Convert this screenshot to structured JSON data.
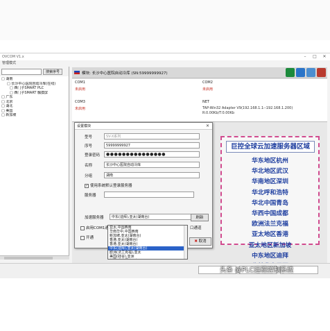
{
  "window": {
    "title": "OVCOM V1.x",
    "menu": "管理模式"
  },
  "left": {
    "search_button": "搜索序号",
    "tree": [
      {
        "label": "□ 湖南",
        "level": 1
      },
      {
        "label": "□ 长沙中心医院自动冷库(在线)",
        "level": 2
      },
      {
        "label": "□ 西门子SMART PLC",
        "level": 3
      },
      {
        "label": "□ 西门子SMART 触摸屏",
        "level": 3
      },
      {
        "label": "□ 广东",
        "level": 1
      },
      {
        "label": "□ 北京",
        "level": 1
      },
      {
        "label": "□ 湖北",
        "level": 1
      },
      {
        "label": "□ 美国",
        "level": 1
      },
      {
        "label": "□ 新加坡",
        "level": 1
      }
    ]
  },
  "device": {
    "title": "模块: 长沙中心医院自动冷库 (SN:59999999927)"
  },
  "ports": {
    "com1": {
      "name": "COM1",
      "state": "未启用"
    },
    "com2": {
      "name": "COM2",
      "state": "未启用"
    },
    "com3": {
      "name": "COM3",
      "state": "未启用"
    },
    "net": {
      "name": "NET",
      "line1": "TAP-Win32 Adapter V9(192.168.1.1--192.168.1.200)",
      "line2": "R:0.00Kb/T:0.00Kb"
    }
  },
  "dialog": {
    "title": "设置模块",
    "labels": {
      "model": "型号",
      "serial": "序号",
      "password": "登录密码",
      "name": "名称",
      "group": "分组",
      "server": "服务器",
      "accel": "加速服务器"
    },
    "values": {
      "model": "SV-X系列",
      "serial": "59999999927",
      "password": "●●●●●●●●●●●●●●●",
      "name": "长沙中心医院自动冷库",
      "group": "湖南",
      "server": "",
      "accel": "中东(迪拜),亚太(湖南台)"
    },
    "use_default_server": "使用系统默认登录服务器",
    "refresh": "刷新",
    "com1_option": "启用COM1通道",
    "com3_option": "开通",
    "com2_suffix": "口通道",
    "cancel": "取消",
    "cancel_icon": "red-x-icon",
    "dropdown_items": [
      "亚太,中国西南",
      "华南华中,中国西南",
      "新加坡,亚太(湖南台)",
      "香港,亚太(湖南台)",
      "香港,亚太(湖南台)",
      "中东(迪拜),亚太(湖南台)",
      "欧洲(法兰克福),亚太",
      "美国(硅谷),亚洲",
      "美国(弗吉尼亚),欧洲"
    ],
    "dropdown_selected_index": 5
  },
  "panel": {
    "title": "巨控全球云加速服务器区域",
    "regions": [
      "华东地区杭州",
      "华北地区武汉",
      "华南地区深圳",
      "华北呼和浩特",
      "华北中国青岛",
      "华西中国成都",
      "欧洲法兰克福",
      "亚太地区香港",
      "亚太地区新加坡",
      "中东地区迪拜",
      "北美弗吉尼亚"
    ]
  },
  "watermark": "头条 @PLC远程控制系统",
  "colors": {
    "region_text": "#1f3fa0",
    "panel_border": "#d14b8f",
    "inactive_state": "#c83226",
    "highlight": "#2a62c8"
  }
}
